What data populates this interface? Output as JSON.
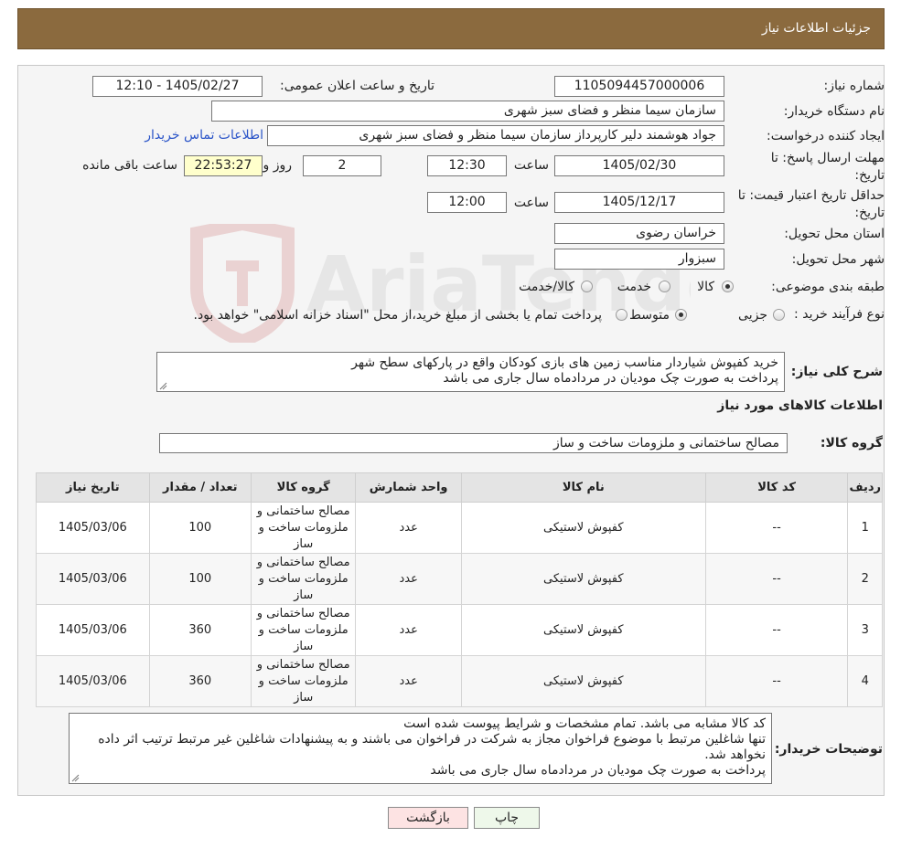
{
  "header": {
    "title": "جزئیات اطلاعات نیاز"
  },
  "fields": {
    "need_number_label": "شماره نیاز:",
    "need_number": "1105094457000006",
    "announce_label": "تاریخ و ساعت اعلان عمومی:",
    "announce_value": "1405/02/27 - 12:10",
    "buyer_org_label": "نام دستگاه خریدار:",
    "buyer_org": "سازمان سیما منظر و فضای سبز شهری",
    "requester_label": "ایجاد کننده درخواست:",
    "requester": "جواد هوشمند دلیر کارپرداز سازمان سیما منظر و فضای سبز شهری",
    "contact_link": "اطلاعات تماس خریدار",
    "deadline_label_1": "مهلت ارسال پاسخ: تا",
    "deadline_label_2": "تاریخ:",
    "deadline_date": "1405/02/30",
    "time_label": "ساعت",
    "deadline_time": "12:30",
    "days_value": "2",
    "days_label": "روز و",
    "remaining_time": "22:53:27",
    "remaining_label": "ساعت باقی مانده",
    "validity_label_1": "حداقل تاریخ اعتبار قیمت: تا",
    "validity_label_2": "تاریخ:",
    "validity_date": "1405/12/17",
    "validity_time": "12:00",
    "province_label": "استان محل تحویل:",
    "province": "خراسان رضوی",
    "city_label": "شهر محل تحویل:",
    "city": "سبزوار",
    "category_label": "طبقه بندی موضوعی:",
    "category_options": [
      "کالا",
      "خدمت",
      "کالا/خدمت"
    ],
    "purchase_type_label": "نوع فرآیند خرید :",
    "purchase_options": [
      "جزیی",
      "متوسط"
    ],
    "purchase_note": "پرداخت تمام یا بخشی از مبلغ خرید،از محل \"اسناد خزانه اسلامی\" خواهد بود."
  },
  "description": {
    "label": "شرح کلی نیاز:",
    "lines": [
      "خرید کفپوش شیاردار مناسب زمین های بازی کودکان واقع در پارکهای سطح شهر",
      "پرداخت به صورت چک مودیان در مردادماه سال جاری می باشد"
    ]
  },
  "goods_section": {
    "title": "اطلاعات کالاهای مورد نیاز",
    "group_label": "گروه کالا:",
    "group_value": "مصالح ساختمانی و ملزومات ساخت و ساز"
  },
  "table": {
    "headers": [
      "ردیف",
      "کد کالا",
      "نام کالا",
      "واحد شمارش",
      "گروه کالا",
      "تعداد / مقدار",
      "تاریخ نیاز"
    ],
    "rows": [
      {
        "idx": "1",
        "code": "--",
        "name": "کفپوش لاستیکی",
        "unit": "عدد",
        "group": "مصالح ساختمانی و ملزومات ساخت و ساز",
        "qty": "100",
        "date": "1405/03/06"
      },
      {
        "idx": "2",
        "code": "--",
        "name": "کفپوش لاستیکی",
        "unit": "عدد",
        "group": "مصالح ساختمانی و ملزومات ساخت و ساز",
        "qty": "100",
        "date": "1405/03/06"
      },
      {
        "idx": "3",
        "code": "--",
        "name": "کفپوش لاستیکی",
        "unit": "عدد",
        "group": "مصالح ساختمانی و ملزومات ساخت و ساز",
        "qty": "360",
        "date": "1405/03/06"
      },
      {
        "idx": "4",
        "code": "--",
        "name": "کفپوش لاستیکی",
        "unit": "عدد",
        "group": "مصالح ساختمانی و ملزومات ساخت و ساز",
        "qty": "360",
        "date": "1405/03/06"
      }
    ]
  },
  "buyer_notes": {
    "label": "توضیحات خریدار:",
    "lines": [
      "کد کالا مشابه می باشد. تمام مشخصات و شرایط پیوست شده است",
      "تنها شاغلین مرتبط با موضوع فراخوان مجاز به شرکت در فراخوان می باشند و به پیشنهادات شاغلین غیر مرتبط  ترتیب اثر داده نخواهد شد.",
      "پرداخت به صورت چک مودیان در مردادماه سال جاری می باشد"
    ]
  },
  "buttons": {
    "print": "چاپ",
    "back": "بازگشت"
  },
  "watermark": {
    "text": "AriaTender.neT"
  },
  "colors": {
    "header_bg": "#8b6a3e",
    "link": "#2a54c8",
    "back_btn_bg": "#fde3e3",
    "print_btn_bg": "#eef8ea"
  }
}
